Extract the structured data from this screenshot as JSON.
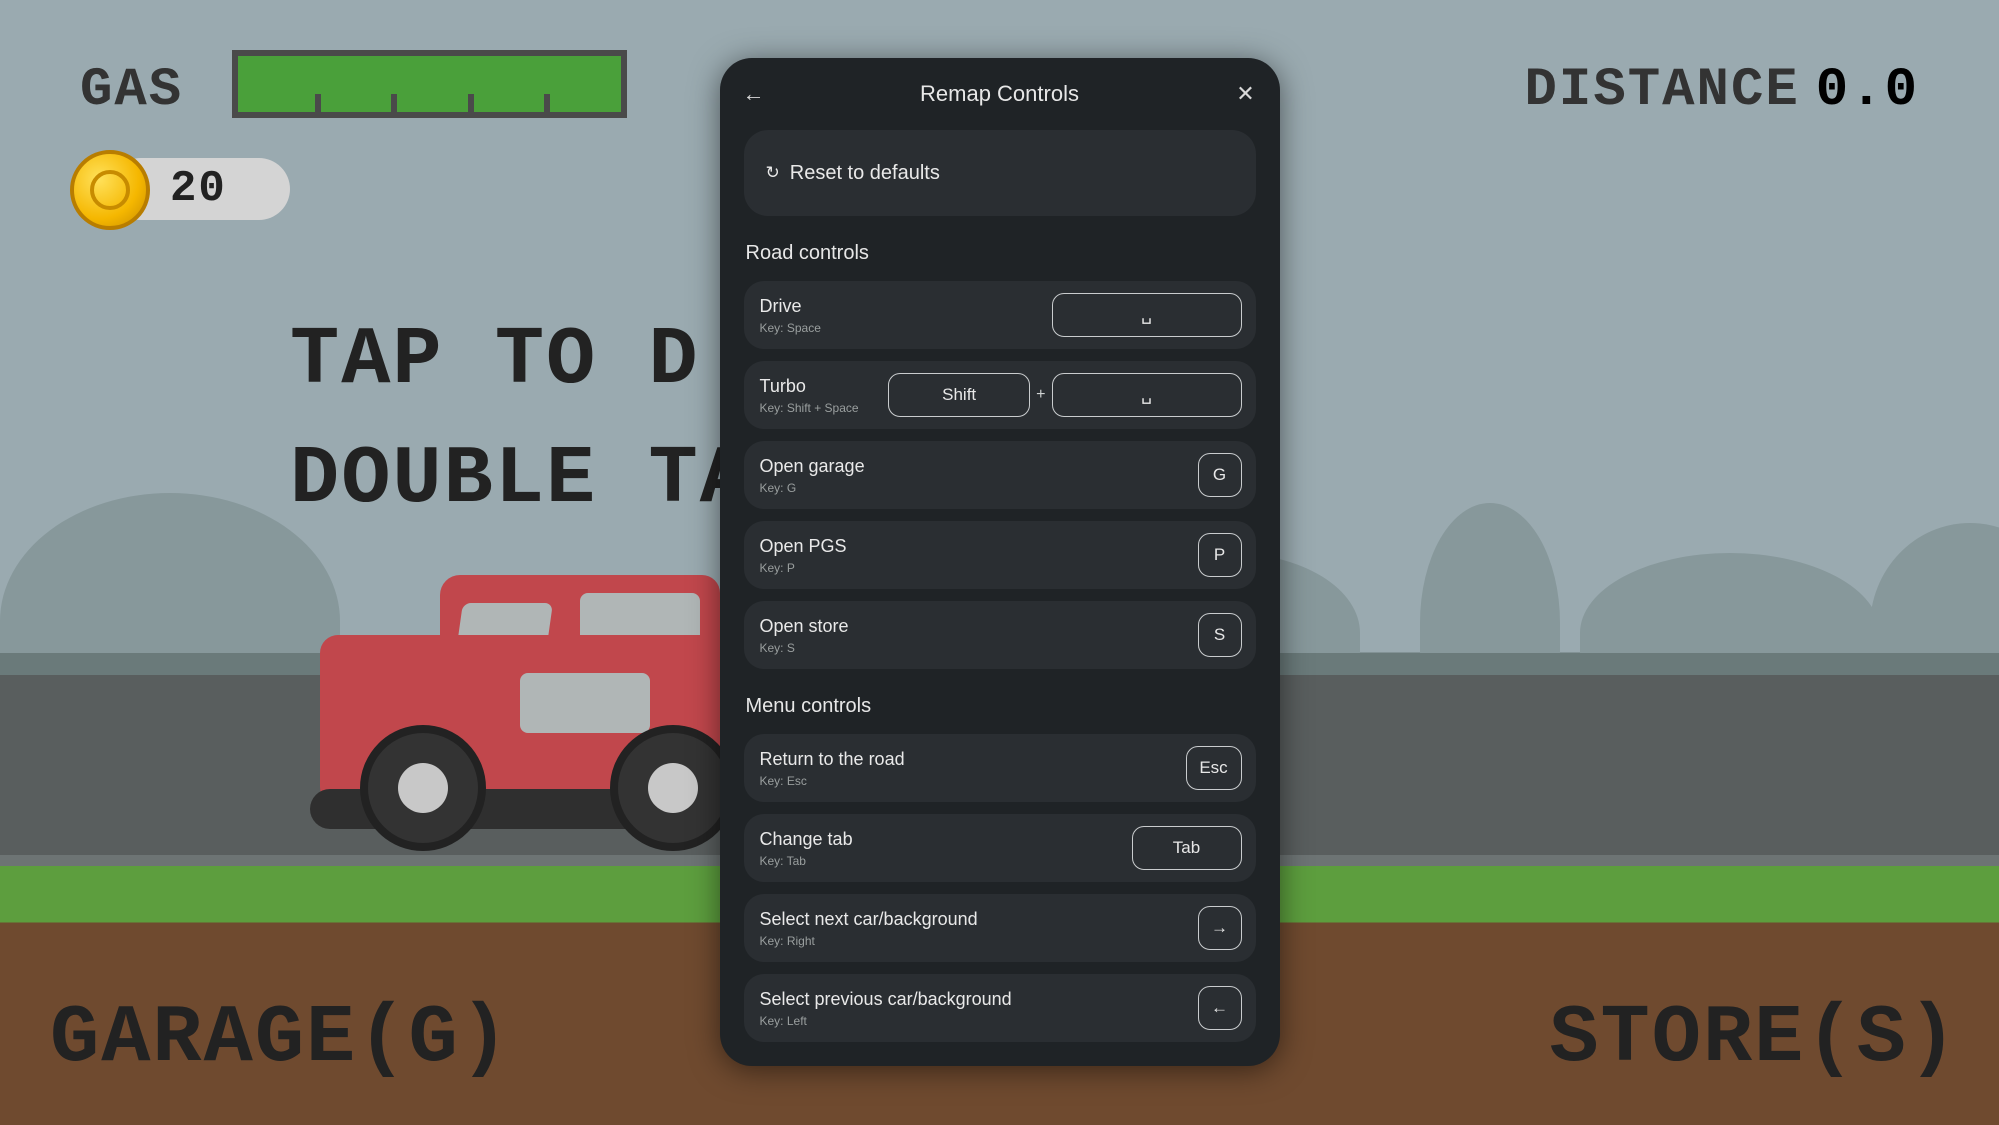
{
  "hud": {
    "gas_label": "Gas",
    "coins": "20",
    "distance_label": "Distance",
    "distance_value": "0.0",
    "tap_line1": "Tap to d",
    "tap_line2": "Double tap",
    "garage_button": "Garage(G)",
    "store_button": "Store(S)"
  },
  "modal": {
    "title": "Remap Controls",
    "reset_label": "Reset to defaults",
    "section1_title": "Road controls",
    "section2_title": "Menu controls",
    "plus": "+",
    "rows": {
      "drive": {
        "title": "Drive",
        "sub": "Key: Space",
        "key1": "␣"
      },
      "turbo": {
        "title": "Turbo",
        "sub": "Key: Shift + Space",
        "key1": "Shift",
        "key2": "␣"
      },
      "garage": {
        "title": "Open garage",
        "sub": "Key: G",
        "key1": "G"
      },
      "pgs": {
        "title": "Open PGS",
        "sub": "Key: P",
        "key1": "P"
      },
      "store": {
        "title": "Open store",
        "sub": "Key: S",
        "key1": "S"
      },
      "return": {
        "title": "Return to the road",
        "sub": "Key: Esc",
        "key1": "Esc"
      },
      "tab": {
        "title": "Change tab",
        "sub": "Key: Tab",
        "key1": "Tab"
      },
      "next": {
        "title": "Select next car/background",
        "sub": "Key: Right",
        "key1": "→"
      },
      "prev": {
        "title": "Select previous car/background",
        "sub": "Key: Left",
        "key1": "←"
      }
    }
  }
}
